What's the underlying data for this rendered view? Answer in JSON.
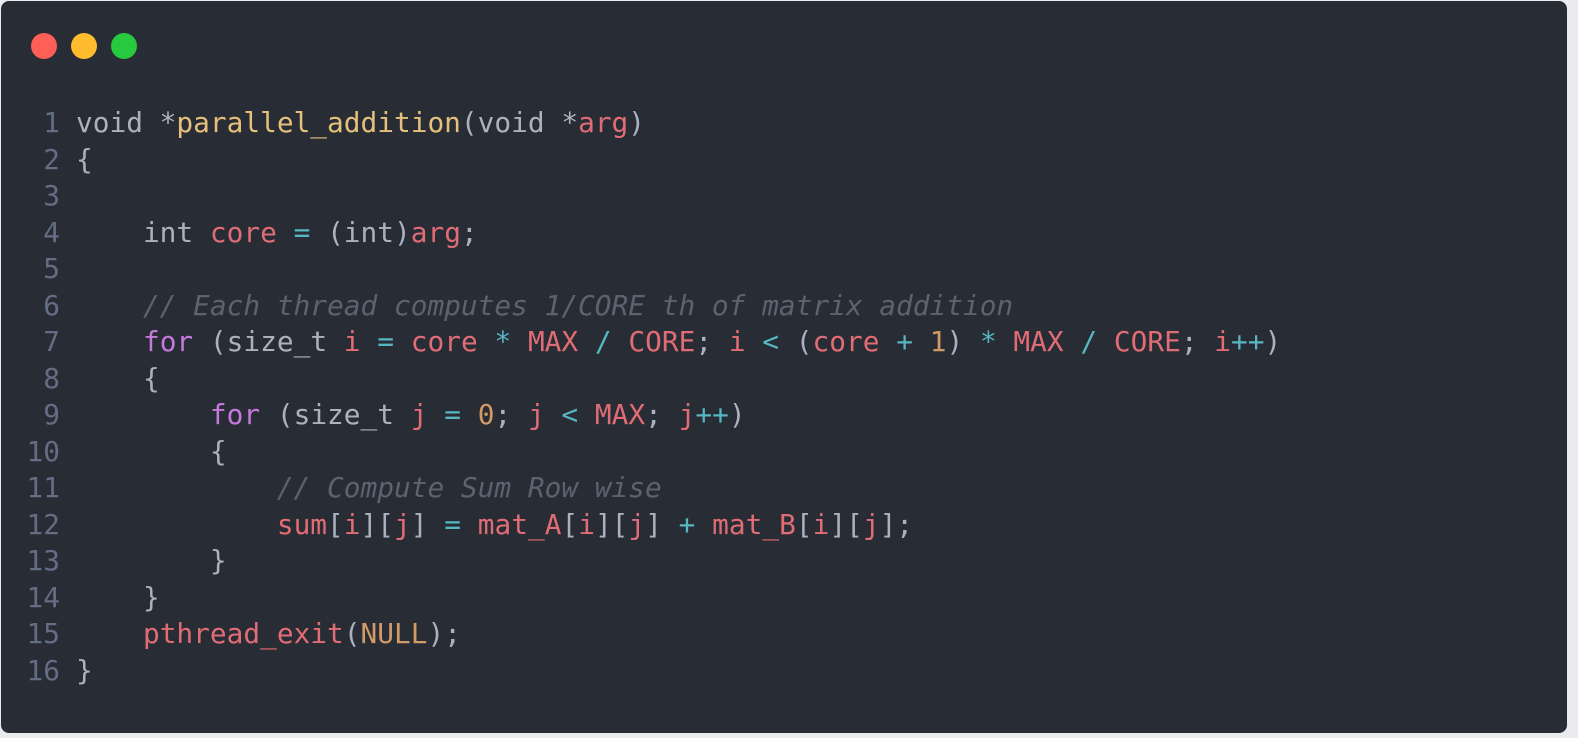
{
  "window": {
    "controls": [
      {
        "name": "close-button",
        "color": "#ff5f56"
      },
      {
        "name": "minimize-button",
        "color": "#ffbd2e"
      },
      {
        "name": "maximize-button",
        "color": "#27c93f"
      }
    ]
  },
  "colors": {
    "background": "#282c34",
    "plain": "#abb2bf",
    "keyword": "#c678dd",
    "function": "#e5c07b",
    "variable": "#e06c75",
    "operator": "#56b6c2",
    "number": "#d19a66",
    "comment": "#5c6370",
    "line_number": "#636d83"
  },
  "code": {
    "lines": [
      {
        "number": "1",
        "tokens": [
          {
            "t": "void *",
            "k": "plain"
          },
          {
            "t": "parallel_addition",
            "k": "fn"
          },
          {
            "t": "(void *",
            "k": "plain"
          },
          {
            "t": "arg",
            "k": "var"
          },
          {
            "t": ")",
            "k": "plain"
          }
        ]
      },
      {
        "number": "2",
        "tokens": [
          {
            "t": "{",
            "k": "plain"
          }
        ]
      },
      {
        "number": "3",
        "tokens": []
      },
      {
        "number": "4",
        "tokens": [
          {
            "t": "    int ",
            "k": "plain"
          },
          {
            "t": "core",
            "k": "var"
          },
          {
            "t": " = ",
            "k": "op"
          },
          {
            "t": "(int)",
            "k": "plain"
          },
          {
            "t": "arg",
            "k": "var"
          },
          {
            "t": ";",
            "k": "plain"
          }
        ]
      },
      {
        "number": "5",
        "tokens": []
      },
      {
        "number": "6",
        "tokens": [
          {
            "t": "    // Each thread computes 1/CORE th of matrix addition",
            "k": "comment"
          }
        ]
      },
      {
        "number": "7",
        "tokens": [
          {
            "t": "    ",
            "k": "plain"
          },
          {
            "t": "for",
            "k": "kw"
          },
          {
            "t": " (size_t ",
            "k": "plain"
          },
          {
            "t": "i",
            "k": "var"
          },
          {
            "t": " = ",
            "k": "op"
          },
          {
            "t": "core",
            "k": "var"
          },
          {
            "t": " * ",
            "k": "op"
          },
          {
            "t": "MAX",
            "k": "var"
          },
          {
            "t": " / ",
            "k": "op"
          },
          {
            "t": "CORE",
            "k": "var"
          },
          {
            "t": "; ",
            "k": "plain"
          },
          {
            "t": "i",
            "k": "var"
          },
          {
            "t": " < ",
            "k": "op"
          },
          {
            "t": "(",
            "k": "plain"
          },
          {
            "t": "core",
            "k": "var"
          },
          {
            "t": " + ",
            "k": "op"
          },
          {
            "t": "1",
            "k": "num"
          },
          {
            "t": ")",
            "k": "plain"
          },
          {
            "t": " * ",
            "k": "op"
          },
          {
            "t": "MAX",
            "k": "var"
          },
          {
            "t": " / ",
            "k": "op"
          },
          {
            "t": "CORE",
            "k": "var"
          },
          {
            "t": "; ",
            "k": "plain"
          },
          {
            "t": "i",
            "k": "var"
          },
          {
            "t": "++",
            "k": "op"
          },
          {
            "t": ")",
            "k": "plain"
          }
        ]
      },
      {
        "number": "8",
        "tokens": [
          {
            "t": "    {",
            "k": "plain"
          }
        ]
      },
      {
        "number": "9",
        "tokens": [
          {
            "t": "        ",
            "k": "plain"
          },
          {
            "t": "for",
            "k": "kw"
          },
          {
            "t": " (size_t ",
            "k": "plain"
          },
          {
            "t": "j",
            "k": "var"
          },
          {
            "t": " = ",
            "k": "op"
          },
          {
            "t": "0",
            "k": "num"
          },
          {
            "t": "; ",
            "k": "plain"
          },
          {
            "t": "j",
            "k": "var"
          },
          {
            "t": " < ",
            "k": "op"
          },
          {
            "t": "MAX",
            "k": "var"
          },
          {
            "t": "; ",
            "k": "plain"
          },
          {
            "t": "j",
            "k": "var"
          },
          {
            "t": "++",
            "k": "op"
          },
          {
            "t": ")",
            "k": "plain"
          }
        ]
      },
      {
        "number": "10",
        "tokens": [
          {
            "t": "        {",
            "k": "plain"
          }
        ]
      },
      {
        "number": "11",
        "tokens": [
          {
            "t": "            // Compute Sum Row wise",
            "k": "comment"
          }
        ]
      },
      {
        "number": "12",
        "tokens": [
          {
            "t": "            ",
            "k": "plain"
          },
          {
            "t": "sum",
            "k": "var"
          },
          {
            "t": "[",
            "k": "plain"
          },
          {
            "t": "i",
            "k": "var"
          },
          {
            "t": "][",
            "k": "plain"
          },
          {
            "t": "j",
            "k": "var"
          },
          {
            "t": "]",
            "k": "plain"
          },
          {
            "t": " = ",
            "k": "op"
          },
          {
            "t": "mat_A",
            "k": "var"
          },
          {
            "t": "[",
            "k": "plain"
          },
          {
            "t": "i",
            "k": "var"
          },
          {
            "t": "][",
            "k": "plain"
          },
          {
            "t": "j",
            "k": "var"
          },
          {
            "t": "]",
            "k": "plain"
          },
          {
            "t": " + ",
            "k": "op"
          },
          {
            "t": "mat_B",
            "k": "var"
          },
          {
            "t": "[",
            "k": "plain"
          },
          {
            "t": "i",
            "k": "var"
          },
          {
            "t": "][",
            "k": "plain"
          },
          {
            "t": "j",
            "k": "var"
          },
          {
            "t": "];",
            "k": "plain"
          }
        ]
      },
      {
        "number": "13",
        "tokens": [
          {
            "t": "        }",
            "k": "plain"
          }
        ]
      },
      {
        "number": "14",
        "tokens": [
          {
            "t": "    }",
            "k": "plain"
          }
        ]
      },
      {
        "number": "15",
        "tokens": [
          {
            "t": "    ",
            "k": "plain"
          },
          {
            "t": "pthread_exit",
            "k": "var"
          },
          {
            "t": "(",
            "k": "plain"
          },
          {
            "t": "NULL",
            "k": "num"
          },
          {
            "t": ");",
            "k": "plain"
          }
        ]
      },
      {
        "number": "16",
        "tokens": [
          {
            "t": "}",
            "k": "plain"
          }
        ]
      }
    ]
  }
}
